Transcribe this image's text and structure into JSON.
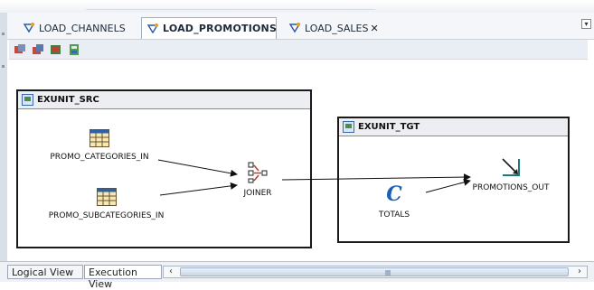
{
  "tabs": [
    {
      "label": "LOAD_CHANNELS",
      "active": false
    },
    {
      "label": "LOAD_PROMOTIONS",
      "active": true
    },
    {
      "label": "LOAD_SALES",
      "active": false,
      "close": "✕"
    }
  ],
  "toolbar": {
    "buttons": [
      "validate-icon",
      "validate-all-icon",
      "execute-icon",
      "deploy-icon"
    ]
  },
  "groups": {
    "src": {
      "title": "EXUNIT_SRC",
      "nodes": [
        {
          "label": "PROMO_CATEGORIES_IN",
          "icon": "table-icon"
        },
        {
          "label": "PROMO_SUBCATEGORIES_IN",
          "icon": "table-icon"
        },
        {
          "label": "JOINER",
          "icon": "joiner-icon"
        }
      ]
    },
    "tgt": {
      "title": "EXUNIT_TGT",
      "nodes": [
        {
          "label": "TOTALS",
          "icon": "constant-icon",
          "glyph": "C"
        },
        {
          "label": "PROMOTIONS_OUT",
          "icon": "target-table-icon"
        }
      ]
    }
  },
  "bottom": {
    "tabs": [
      {
        "label": "Logical View",
        "active": false
      },
      {
        "label": "Execution View",
        "active": true
      }
    ]
  },
  "colors": {
    "accent": "#1d5fb3",
    "grid": "#1a1a1a"
  }
}
